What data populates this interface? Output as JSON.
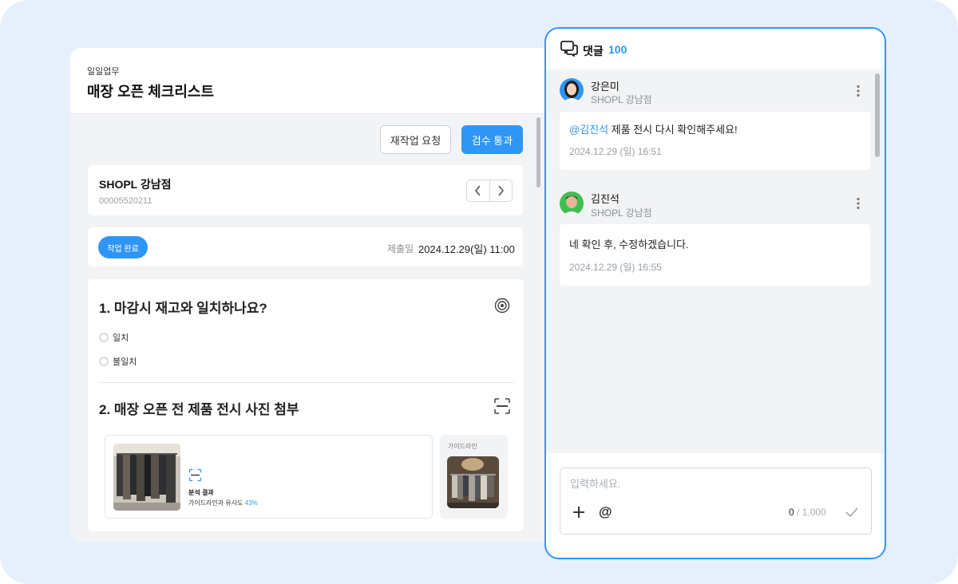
{
  "task": {
    "category": "일일업무",
    "title": "매장 오픈 체크리스트",
    "rework_button": "재작업 요청",
    "pass_button": "검수 통과",
    "store": {
      "name": "SHOPL 강남점",
      "code": "00005520211"
    },
    "status": {
      "badge": "작업 완료",
      "submit_label": "제출일",
      "submit_date": "2024.12.29(일) 11:00"
    },
    "questions": [
      {
        "title": "1. 마감시 재고와 일치하나요?",
        "options": [
          "일치",
          "불일치"
        ]
      },
      {
        "title": "2. 매장 오픈 전 제품 전시 사진 첨부"
      }
    ],
    "analysis": {
      "title": "분석 결과",
      "text": "가이드라인과 유사도",
      "similarity": "43%"
    },
    "guide_label": "가이드라인"
  },
  "comments": {
    "title": "댓글",
    "count": "100",
    "items": [
      {
        "author": "강은미",
        "store": "SHOPL 강남점",
        "mention": "@김진석",
        "text": " 제품 전시 다시 확인해주세요!",
        "time": "2024.12.29 (일) 16:51"
      },
      {
        "author": "김진석",
        "store": "SHOPL 강남점",
        "mention": "",
        "text": "네 확인 후, 수정하겠습니다.",
        "time": "2024.12.29 (일) 16:55"
      }
    ],
    "input": {
      "placeholder": "입력하세요.",
      "value": "",
      "counter_current": "0",
      "counter_max": " / 1,000"
    }
  },
  "icons": [
    "comment-icon",
    "chevron-left-icon",
    "chevron-right-icon",
    "target-icon",
    "scan-icon",
    "more-vertical-icon",
    "plus-icon",
    "at-icon",
    "check-icon"
  ],
  "colors": {
    "accent": "#2f96f5",
    "background": "#e6f0fc",
    "panel": "#f2f3f5"
  }
}
